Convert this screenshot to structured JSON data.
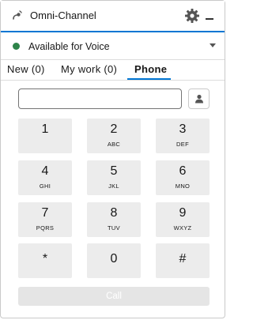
{
  "header": {
    "title": "Omni-Channel"
  },
  "status": {
    "label": "Available for Voice",
    "color": "#2e844a"
  },
  "tabs": [
    {
      "label": "New (0)",
      "active": false
    },
    {
      "label": "My work (0)",
      "active": false
    },
    {
      "label": "Phone",
      "active": true
    }
  ],
  "dialer": {
    "input_value": "",
    "keys": [
      {
        "digit": "1",
        "letters": ""
      },
      {
        "digit": "2",
        "letters": "ABC"
      },
      {
        "digit": "3",
        "letters": "DEF"
      },
      {
        "digit": "4",
        "letters": "GHI"
      },
      {
        "digit": "5",
        "letters": "JKL"
      },
      {
        "digit": "6",
        "letters": "MNO"
      },
      {
        "digit": "7",
        "letters": "PQRS"
      },
      {
        "digit": "8",
        "letters": "TUV"
      },
      {
        "digit": "9",
        "letters": "WXYZ"
      },
      {
        "digit": "*",
        "letters": ""
      },
      {
        "digit": "0",
        "letters": ""
      },
      {
        "digit": "#",
        "letters": ""
      }
    ],
    "call_label": "Call"
  },
  "icons": {
    "app": "omni-channel-icon",
    "settings": "gear-icon",
    "minimize": "minimize-icon",
    "dropdown": "chevron-down-icon",
    "contact": "person-icon"
  },
  "colors": {
    "accent": "#0176d3",
    "key_bg": "#ececec",
    "call_disabled_bg": "#e5e5e5"
  }
}
